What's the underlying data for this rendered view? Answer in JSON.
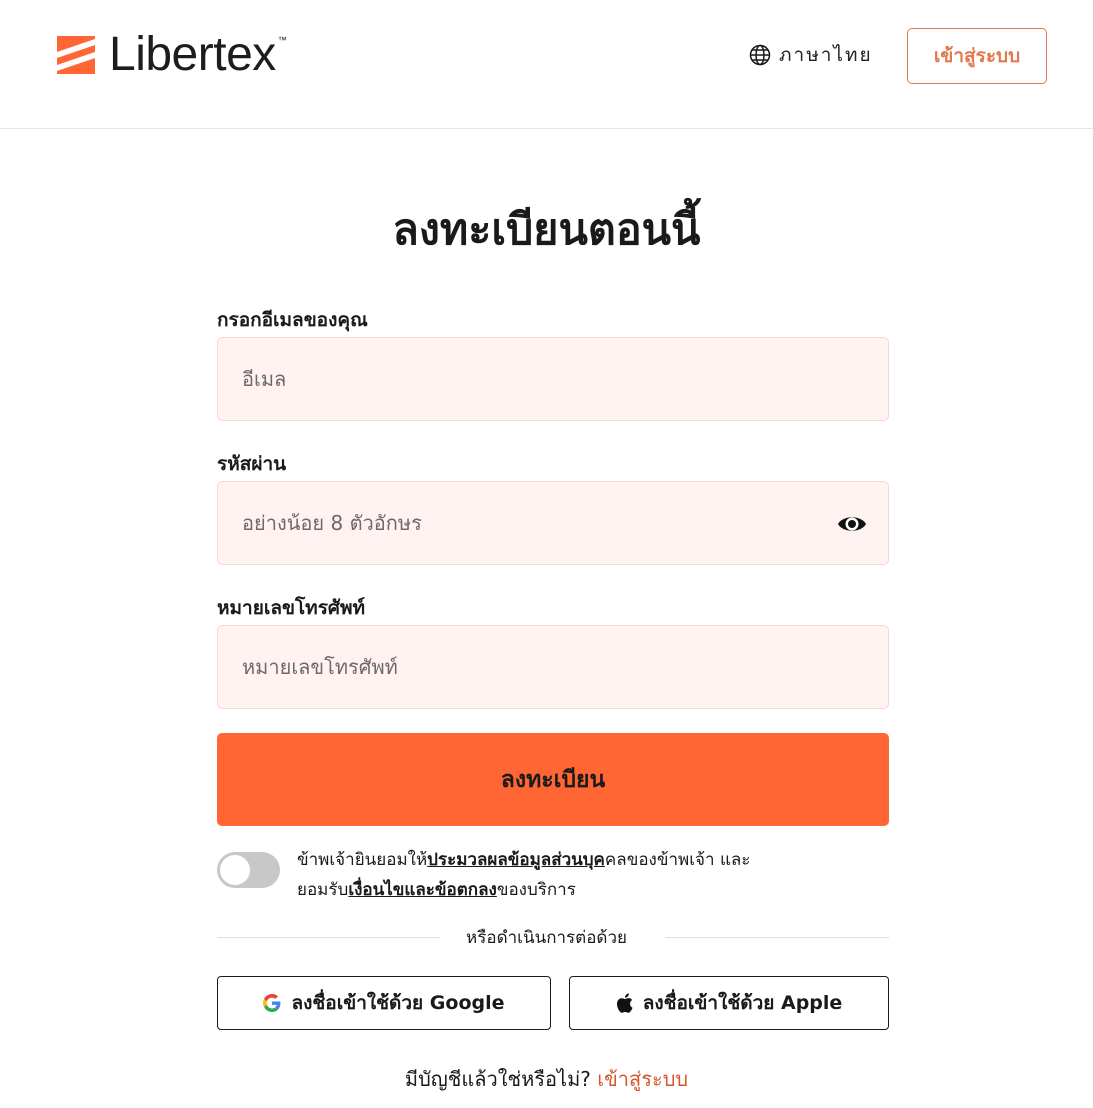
{
  "header": {
    "logo_text": "Libertex",
    "logo_tm": "™",
    "language_label": "ภาษาไทย",
    "login_button": "เข้าสู่ระบบ"
  },
  "main": {
    "title": "ลงทะเบียนตอนนี้",
    "email": {
      "label": "กรอกอีเมลของคุณ",
      "placeholder": "อีเมล",
      "value": ""
    },
    "password": {
      "label": "รหัสผ่าน",
      "placeholder": "อย่างน้อย 8 ตัวอักษร",
      "value": ""
    },
    "phone": {
      "label": "หมายเลขโทรศัพท์",
      "placeholder": "หมายเลขโทรศัพท์",
      "value": ""
    },
    "submit_button": "ลงทะเบียน",
    "consent": {
      "checked": false,
      "text_1": "ข้าพเจ้ายินยอมให้",
      "link_privacy": "ประมวลผลข้อมูลส่วนบุค",
      "text_2": "คลของข้าพเจ้า และ",
      "text_3": "ยอมรับ",
      "link_terms": "เงื่อนไขและข้อตกลง",
      "text_4": "ของบริการ"
    },
    "divider_text": "หรือดำเนินการต่อด้วย",
    "google_button": "ลงชื่อเข้าใช้ด้วย Google",
    "apple_button": "ลงชื่อเข้าใช้ด้วย Apple",
    "have_account_text": "มีบัญชีแล้วใช่หรือไม่?",
    "have_account_link": "เข้าสู่ระบบ"
  },
  "colors": {
    "brand_orange": "#ff6633",
    "link_orange": "#d9552b",
    "outline_orange": "#e27a4e",
    "field_bg": "#fff2f0"
  },
  "icons": [
    "libertex-logo-icon",
    "globe-icon",
    "eye-icon",
    "google-icon",
    "apple-icon"
  ]
}
